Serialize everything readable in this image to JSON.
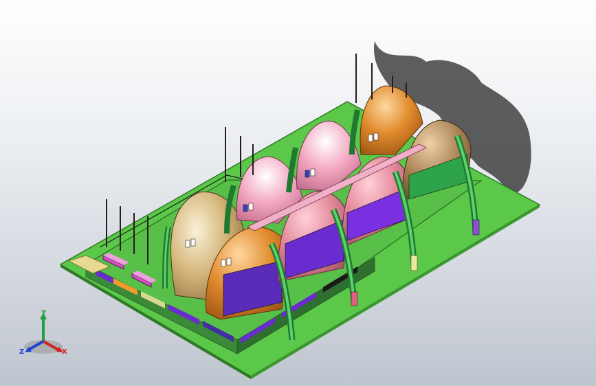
{
  "viewport": {
    "background_top": "#ffffff",
    "background_bottom": "#bfc5cf"
  },
  "colors": {
    "ground": "#5cc84a",
    "ground_edge": "#2f7a26",
    "podium": "#64c85a",
    "shell_gold": "#d4b67a",
    "shell_orange": "#d9822a",
    "shell_pink": "#f3a5c0",
    "shell_rose": "#e48a9c",
    "shell_tan": "#b08a5c",
    "glass_purple": "#6a2bd0",
    "glass_green": "#2fa34a",
    "arch_green": "#33b44a",
    "shadow": "#2a2a2a"
  },
  "triad": {
    "x_label": "X",
    "y_label": "Y",
    "z_label": "Z",
    "x_color": "#d42020",
    "y_color": "#20a040",
    "z_color": "#2040d0"
  }
}
